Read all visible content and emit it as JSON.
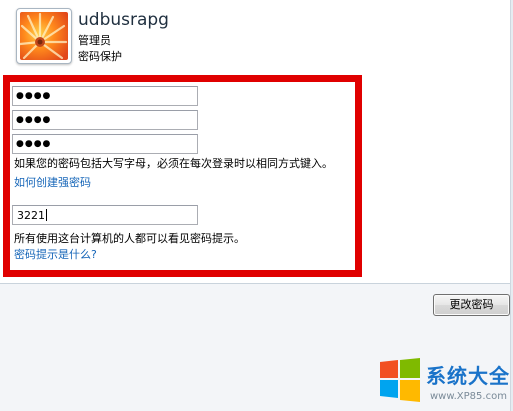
{
  "user": {
    "name": "udbusrapg",
    "role": "管理员",
    "status": "密码保护"
  },
  "form": {
    "current_password": "●●●●",
    "new_password": "●●●●",
    "confirm_password": "●●●●",
    "case_note": "如果您的密码包括大写字母，必须在每次登录时以相同方式键入。",
    "strong_password_link": "如何创建强密码",
    "hint_value": "3221",
    "hint_note": "所有使用这台计算机的人都可以看见密码提示。",
    "hint_help_link": "密码提示是什么?"
  },
  "buttons": {
    "change_password": "更改密码"
  },
  "watermark": {
    "brand": "系统大全",
    "url": "www.XP85.com"
  },
  "colors": {
    "highlight_box": "#e00000",
    "link": "#1565b8"
  }
}
